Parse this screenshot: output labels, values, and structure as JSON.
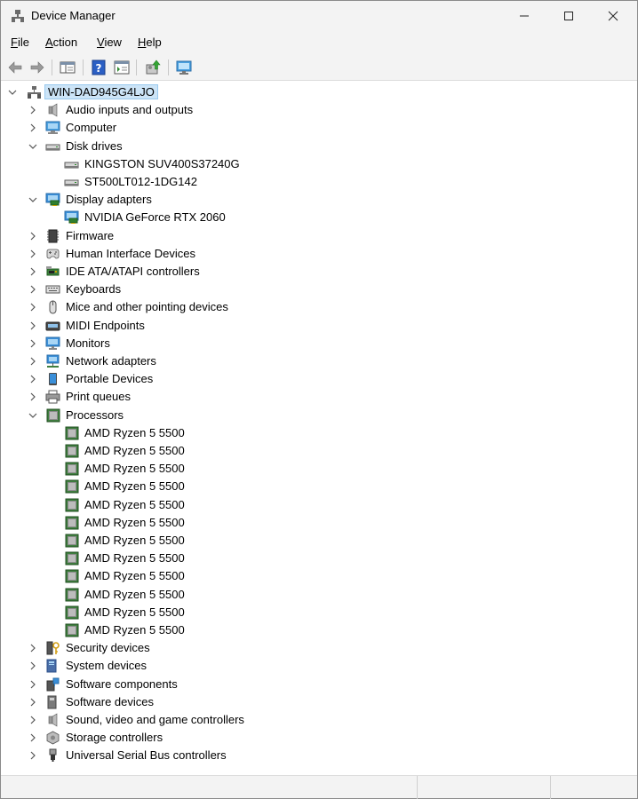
{
  "window": {
    "title": "Device Manager",
    "controls": [
      "minimize",
      "maximize",
      "close"
    ]
  },
  "menu": [
    {
      "key": "F",
      "rest": "ile"
    },
    {
      "key": "A",
      "rest": "ction"
    },
    {
      "key": "V",
      "rest": "iew"
    },
    {
      "key": "H",
      "rest": "elp"
    }
  ],
  "toolbar": {
    "buttons": [
      "back-icon",
      "forward-icon",
      "show-hide-console-tree-icon",
      "help-icon",
      "properties-icon",
      "update-driver-icon",
      "scan-hardware-icon"
    ]
  },
  "tree": {
    "root": "WIN-DAD945G4LJO",
    "categories": [
      {
        "label": "Audio inputs and outputs",
        "icon": "speaker-icon",
        "expanded": false,
        "children": []
      },
      {
        "label": "Computer",
        "icon": "computer-icon",
        "expanded": false,
        "children": []
      },
      {
        "label": "Disk drives",
        "icon": "disk-drive-icon",
        "expanded": true,
        "children": [
          {
            "label": "KINGSTON SUV400S37240G",
            "icon": "disk-drive-icon"
          },
          {
            "label": "ST500LT012-1DG142",
            "icon": "disk-drive-icon"
          }
        ]
      },
      {
        "label": "Display adapters",
        "icon": "display-adapter-icon",
        "expanded": true,
        "children": [
          {
            "label": "NVIDIA GeForce RTX 2060",
            "icon": "display-adapter-icon"
          }
        ]
      },
      {
        "label": "Firmware",
        "icon": "firmware-icon",
        "expanded": false,
        "children": []
      },
      {
        "label": "Human Interface Devices",
        "icon": "hid-icon",
        "expanded": false,
        "children": []
      },
      {
        "label": "IDE ATA/ATAPI controllers",
        "icon": "ide-controller-icon",
        "expanded": false,
        "children": []
      },
      {
        "label": "Keyboards",
        "icon": "keyboard-icon",
        "expanded": false,
        "children": []
      },
      {
        "label": "Mice and other pointing devices",
        "icon": "mouse-icon",
        "expanded": false,
        "children": []
      },
      {
        "label": "MIDI Endpoints",
        "icon": "midi-icon",
        "expanded": false,
        "children": []
      },
      {
        "label": "Monitors",
        "icon": "monitor-icon",
        "expanded": false,
        "children": []
      },
      {
        "label": "Network adapters",
        "icon": "network-adapter-icon",
        "expanded": false,
        "children": []
      },
      {
        "label": "Portable Devices",
        "icon": "portable-device-icon",
        "expanded": false,
        "children": []
      },
      {
        "label": "Print queues",
        "icon": "printer-icon",
        "expanded": false,
        "children": []
      },
      {
        "label": "Processors",
        "icon": "processor-icon",
        "expanded": true,
        "children": [
          {
            "label": "AMD Ryzen 5 5500",
            "icon": "processor-icon"
          },
          {
            "label": "AMD Ryzen 5 5500",
            "icon": "processor-icon"
          },
          {
            "label": "AMD Ryzen 5 5500",
            "icon": "processor-icon"
          },
          {
            "label": "AMD Ryzen 5 5500",
            "icon": "processor-icon"
          },
          {
            "label": "AMD Ryzen 5 5500",
            "icon": "processor-icon"
          },
          {
            "label": "AMD Ryzen 5 5500",
            "icon": "processor-icon"
          },
          {
            "label": "AMD Ryzen 5 5500",
            "icon": "processor-icon"
          },
          {
            "label": "AMD Ryzen 5 5500",
            "icon": "processor-icon"
          },
          {
            "label": "AMD Ryzen 5 5500",
            "icon": "processor-icon"
          },
          {
            "label": "AMD Ryzen 5 5500",
            "icon": "processor-icon"
          },
          {
            "label": "AMD Ryzen 5 5500",
            "icon": "processor-icon"
          },
          {
            "label": "AMD Ryzen 5 5500",
            "icon": "processor-icon"
          }
        ]
      },
      {
        "label": "Security devices",
        "icon": "security-key-icon",
        "expanded": false,
        "children": []
      },
      {
        "label": "System devices",
        "icon": "system-device-icon",
        "expanded": false,
        "children": []
      },
      {
        "label": "Software components",
        "icon": "software-component-icon",
        "expanded": false,
        "children": []
      },
      {
        "label": "Software devices",
        "icon": "software-device-icon",
        "expanded": false,
        "children": []
      },
      {
        "label": "Sound, video and game controllers",
        "icon": "speaker-icon",
        "expanded": false,
        "children": []
      },
      {
        "label": "Storage controllers",
        "icon": "storage-controller-icon",
        "expanded": false,
        "children": []
      },
      {
        "label": "Universal Serial Bus controllers",
        "icon": "usb-icon",
        "expanded": false,
        "children": []
      }
    ]
  },
  "colors": {
    "chrome": "#f3f3f3",
    "selection": "#cce4f7",
    "selection_border": "#99c9ef",
    "monitor_blue": "#3a8fd9",
    "processor_green": "#3f7f3f"
  }
}
